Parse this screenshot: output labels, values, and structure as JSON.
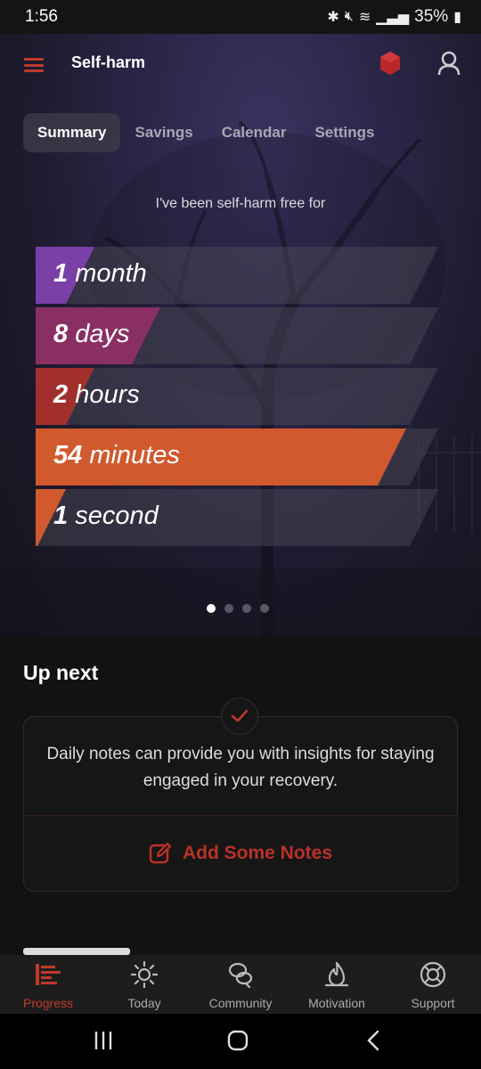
{
  "status_bar": {
    "time": "1:56",
    "battery": "35%"
  },
  "app_bar": {
    "title": "Self-harm"
  },
  "tabs": [
    {
      "label": "Summary",
      "active": true
    },
    {
      "label": "Savings",
      "active": false
    },
    {
      "label": "Calendar",
      "active": false
    },
    {
      "label": "Settings",
      "active": false
    }
  ],
  "summary": {
    "free_label": "I've been self-harm free for",
    "stats": [
      {
        "value": "1",
        "unit": "month",
        "color": "#7b3fa8"
      },
      {
        "value": "8",
        "unit": "days",
        "color": "#8a2f63"
      },
      {
        "value": "2",
        "unit": "hours",
        "color": "#a1302c"
      },
      {
        "value": "54",
        "unit": "minutes",
        "color": "#d0592e"
      },
      {
        "value": "1",
        "unit": "second",
        "color": "#d0592e"
      }
    ],
    "page_count": 4,
    "active_page": 1
  },
  "up_next": {
    "title": "Up next",
    "card_text": "Daily notes can provide you with insights for staying engaged in your recovery.",
    "button_label": "Add Some Notes"
  },
  "bottom_nav": [
    {
      "label": "Progress",
      "icon": "progress-icon",
      "active": true
    },
    {
      "label": "Today",
      "icon": "sun-icon",
      "active": false
    },
    {
      "label": "Community",
      "icon": "community-icon",
      "active": false
    },
    {
      "label": "Motivation",
      "icon": "flame-icon",
      "active": false
    },
    {
      "label": "Support",
      "icon": "lifebuoy-icon",
      "active": false
    }
  ],
  "colors": {
    "accent": "#c0392b",
    "background": "#121212"
  }
}
